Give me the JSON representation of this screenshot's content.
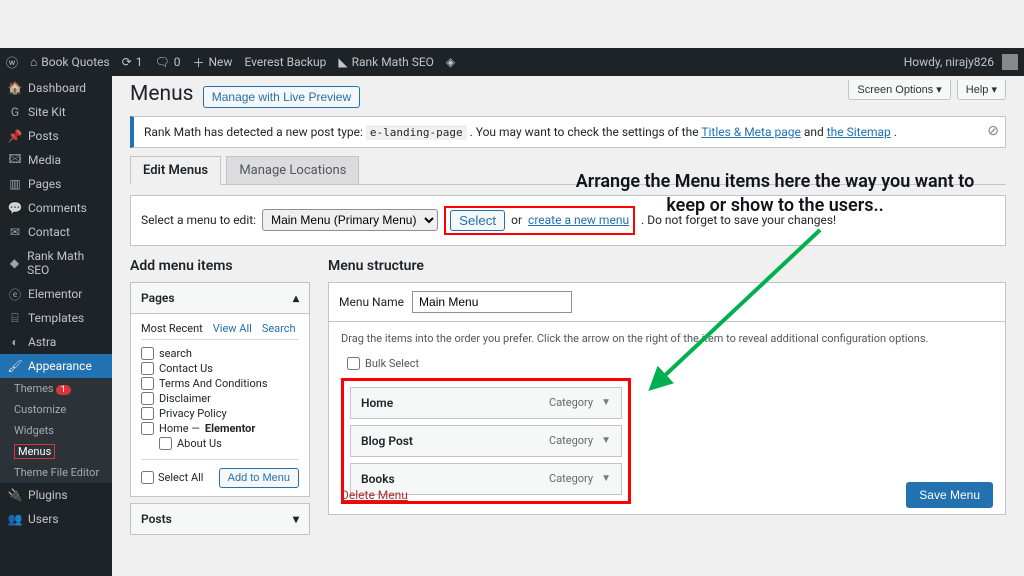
{
  "adminbar": {
    "site_title": "Book Quotes",
    "updates": "1",
    "comments": "0",
    "new_label": "New",
    "everest_label": "Everest Backup",
    "rankmath_label": "Rank Math SEO",
    "howdy": "Howdy, nirajy826"
  },
  "sidebar": {
    "items": [
      {
        "icon": "🏠",
        "label": "Dashboard"
      },
      {
        "icon": "G",
        "label": "Site Kit"
      },
      {
        "icon": "📌",
        "label": "Posts"
      },
      {
        "icon": "🖾",
        "label": "Media"
      },
      {
        "icon": "▥",
        "label": "Pages"
      },
      {
        "icon": "💬",
        "label": "Comments"
      },
      {
        "icon": "✉",
        "label": "Contact"
      },
      {
        "icon": "◆",
        "label": "Rank Math SEO"
      },
      {
        "icon": "ⓔ",
        "label": "Elementor"
      },
      {
        "icon": "⌸",
        "label": "Templates"
      },
      {
        "icon": "◐",
        "label": "Astra"
      },
      {
        "icon": "🖌",
        "label": "Appearance"
      }
    ],
    "appearance_sub": [
      {
        "label": "Themes",
        "badge": "1"
      },
      {
        "label": "Customize"
      },
      {
        "label": "Widgets"
      },
      {
        "label": "Menus",
        "active": true
      },
      {
        "label": "Theme File Editor"
      }
    ],
    "plugins_label": "Plugins",
    "users_label": "Users"
  },
  "screen": {
    "screen_options": "Screen Options ▾",
    "help": "Help ▾"
  },
  "header": {
    "title": "Menus",
    "live_preview": "Manage with Live Preview"
  },
  "notice": {
    "leading": "Rank Math has detected a new post type: ",
    "code": "e-landing-page",
    "middle": " . You may want to check the settings of the ",
    "link1": "Titles & Meta page",
    "and": " and ",
    "link2": "the Sitemap",
    "trailing": "."
  },
  "tabs": {
    "edit": "Edit Menus",
    "locations": "Manage Locations"
  },
  "select_row": {
    "label": "Select a menu to edit:",
    "selected": "Main Menu (Primary Menu)",
    "select_btn": "Select",
    "or": "or",
    "create_link": "create a new menu",
    "trailing": ". Do not forget to save your changes!"
  },
  "left_col": {
    "heading": "Add menu items",
    "pages_head": "Pages",
    "tabs": {
      "recent": "Most Recent",
      "viewall": "View All",
      "search": "Search"
    },
    "pages": [
      "search",
      "Contact Us",
      "Terms And Conditions",
      "Disclaimer",
      "Privacy Policy"
    ],
    "home_page": "Home — ",
    "home_page_em": "Elementor",
    "home_child": "About Us",
    "select_all": "Select All",
    "add_btn": "Add to Menu",
    "posts_head": "Posts"
  },
  "right_col": {
    "heading": "Menu structure",
    "menu_name_label": "Menu Name",
    "menu_name_value": "Main Menu",
    "hint": "Drag the items into the order you prefer. Click the arrow on the right of the item to reveal additional configuration options.",
    "bulk_select": "Bulk Select",
    "items": [
      {
        "title": "Home",
        "type": "Category"
      },
      {
        "title": "Blog Post",
        "type": "Category"
      },
      {
        "title": "Books",
        "type": "Category"
      }
    ],
    "delete": "Delete Menu",
    "save": "Save Menu"
  },
  "annotation": "Arrange the Menu items here the way you want to keep or show to the users.."
}
